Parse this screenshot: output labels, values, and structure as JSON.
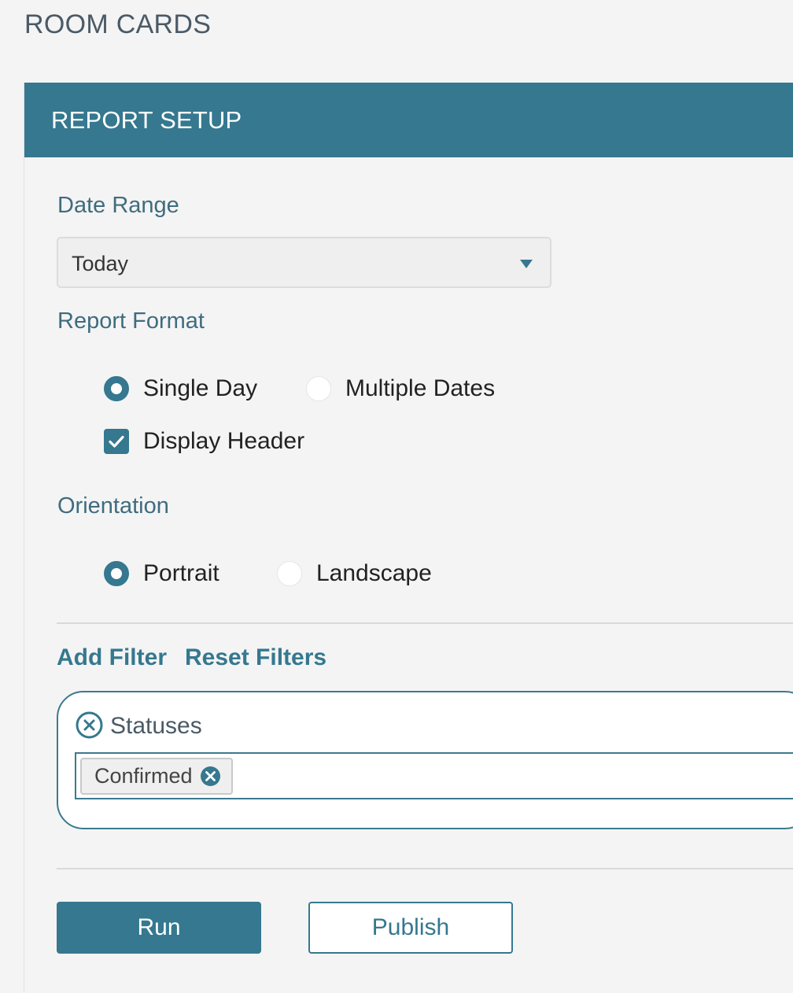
{
  "page": {
    "title": "ROOM CARDS"
  },
  "panel": {
    "title": "REPORT SETUP"
  },
  "date_range": {
    "label": "Date Range",
    "selected": "Today"
  },
  "report_format": {
    "label": "Report Format",
    "options": [
      {
        "label": "Single Day",
        "checked": true
      },
      {
        "label": "Multiple Dates",
        "checked": false
      }
    ],
    "display_header": {
      "label": "Display Header",
      "checked": true
    }
  },
  "orientation": {
    "label": "Orientation",
    "options": [
      {
        "label": "Portrait",
        "checked": true
      },
      {
        "label": "Landscape",
        "checked": false
      }
    ]
  },
  "filters": {
    "add_label": "Add Filter",
    "reset_label": "Reset Filters",
    "items": [
      {
        "name": "Statuses",
        "tags": [
          "Confirmed"
        ]
      }
    ]
  },
  "actions": {
    "run_label": "Run",
    "publish_label": "Publish"
  },
  "colors": {
    "accent": "#35788f",
    "background": "#f4f4f4"
  }
}
